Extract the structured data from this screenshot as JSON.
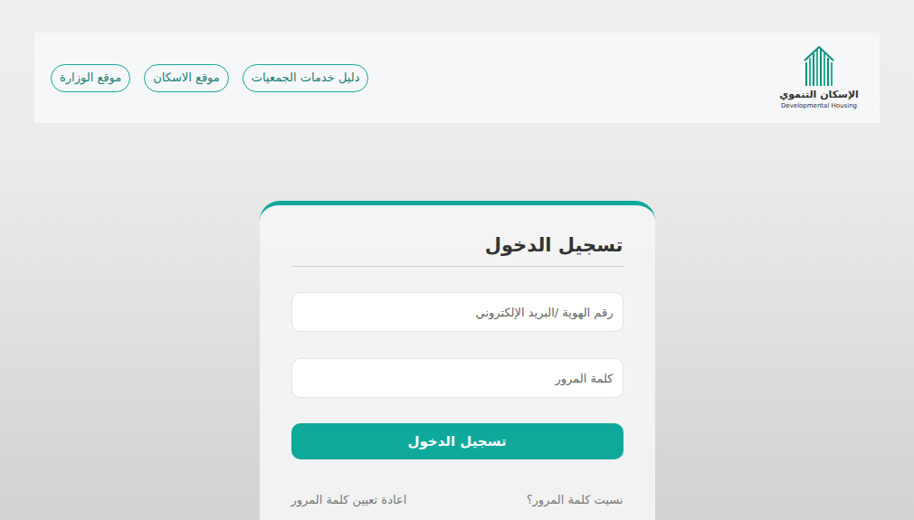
{
  "header": {
    "logo": {
      "title": "الإسكان التنموي",
      "subtitle": "Developmental Housing"
    },
    "links": [
      "دليل خدمات الجمعيات",
      "موقع الاسكان",
      "موقع الوزارة"
    ]
  },
  "login": {
    "title": "تسجيل الدخول",
    "fields": [
      {
        "placeholder": "رقم الهوية /البريد الإلكتروني",
        "kind": "text"
      },
      {
        "placeholder": "كلمة المرور",
        "kind": "password"
      }
    ],
    "submit": "تسجيل الدخول",
    "links": [
      "نسيت كلمة المرور؟",
      "اعادة تعيين كلمة المرور"
    ]
  }
}
